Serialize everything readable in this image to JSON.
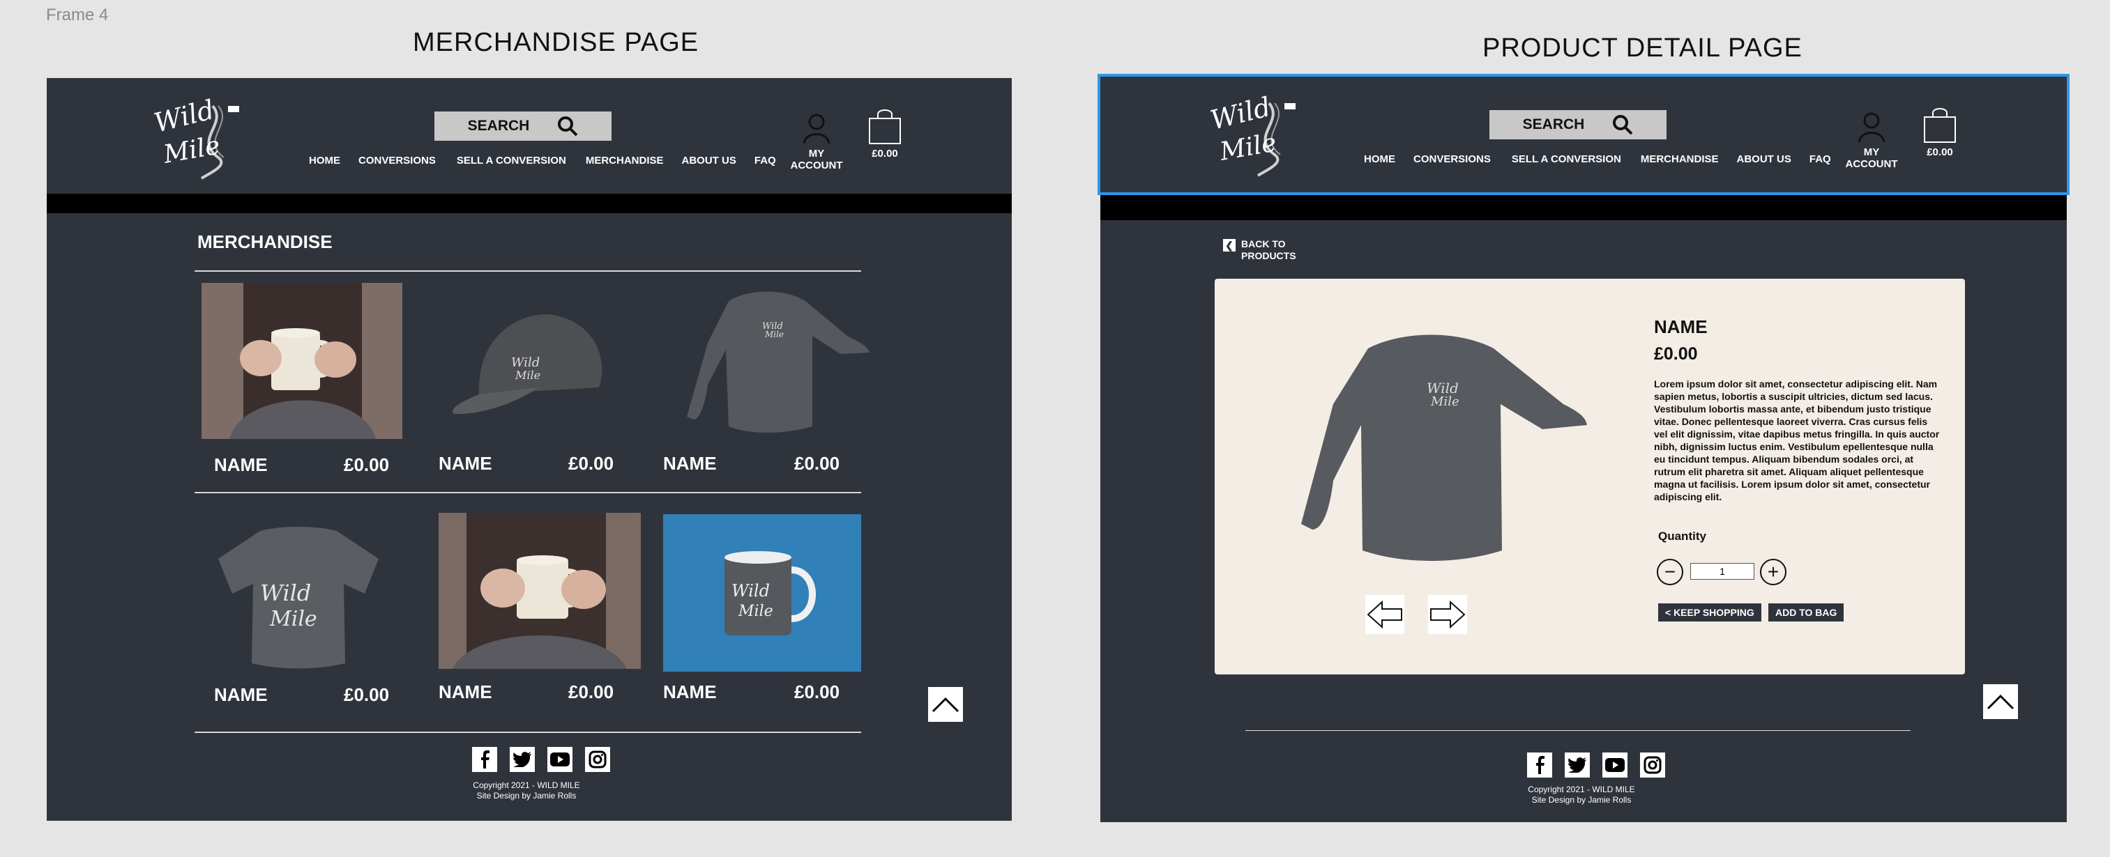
{
  "frame_label": "Frame 4",
  "merch": {
    "page_title": "MERCHANDISE PAGE",
    "section_title": "MERCHANDISE",
    "products": [
      {
        "name": "NAME",
        "price": "£0.00"
      },
      {
        "name": "NAME",
        "price": "£0.00"
      },
      {
        "name": "NAME",
        "price": "£0.00"
      },
      {
        "name": "NAME",
        "price": "£0.00"
      },
      {
        "name": "NAME",
        "price": "£0.00"
      },
      {
        "name": "NAME",
        "price": "£0.00"
      }
    ]
  },
  "detail": {
    "page_title": "PRODUCT DETAIL PAGE",
    "back_line1": "BACK TO",
    "back_line2": "PRODUCTS",
    "name": "NAME",
    "price": "£0.00",
    "description": "Lorem ipsum dolor sit amet, consectetur adipiscing elit. Nam sapien metus, lobortis a suscipit ultricies, dictum sed lacus. Vestibulum lobortis massa ante, et bibendum justo tristique vitae. Donec pellentesque laoreet viverra. Cras cursus felis vel elit dignissim, vitae dapibus metus fringilla. In quis auctor nibh, dignissim luctus enim. Vestibulum epellentesque nulla eu tincidunt tempus. Aliquam bibendum sodales orci, at rutrum elit pharetra sit amet. Aliquam aliquet pellentesque magna ut facilisis. Lorem ipsum dolor sit amet, consectetur adipiscing elit.",
    "quantity_label": "Quantity",
    "quantity_value": "1",
    "keep_shopping": "< KEEP SHOPPING",
    "add_to_bag": "ADD TO BAG"
  },
  "header": {
    "logo_line1": "Wild",
    "logo_line2": "Mile",
    "search_label": "SEARCH",
    "nav": [
      "HOME",
      "CONVERSIONS",
      "SELL A CONVERSION",
      "MERCHANDISE",
      "ABOUT US",
      "FAQ"
    ],
    "account_label": "MY ACCOUNT",
    "bag_total": "£0.00"
  },
  "footer": {
    "copyright": "Copyright 2021 - WILD MILE",
    "design": "Site Design by Jamie Rolls",
    "social_icons": [
      "facebook-icon",
      "twitter-icon",
      "youtube-icon",
      "instagram-icon"
    ]
  },
  "colors": {
    "panel": "#2f343c",
    "card": "#f3ede6",
    "selection": "#2e97e6",
    "mug_bg": "#2f7fb8"
  }
}
